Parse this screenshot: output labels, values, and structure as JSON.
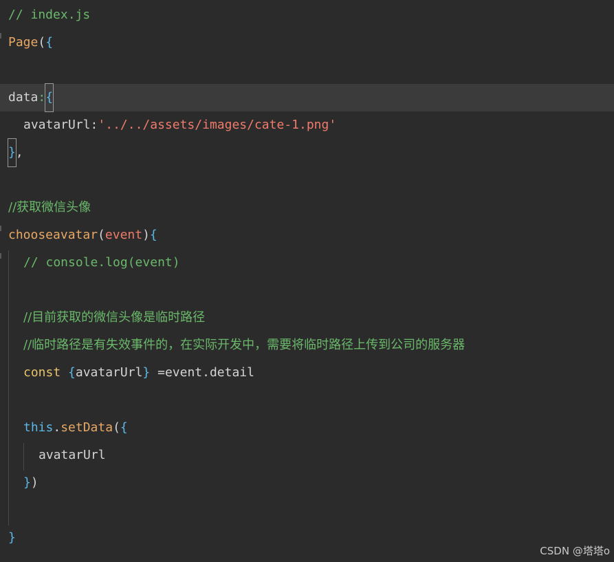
{
  "code": {
    "l1_comment": "// index.js",
    "l2_func": "Page",
    "l2_paren": "(",
    "l2_brace": "{",
    "l4_prop": "data",
    "l4_colon": ":",
    "l4_brace": "{",
    "l5_prop": "avatarUrl",
    "l5_colon": ":",
    "l5_string": "'../../assets/images/cate-1.png'",
    "l6_brace": "}",
    "l6_comma": ",",
    "l8_comment": "//获取微信头像",
    "l9_func": "chooseavatar",
    "l9_paren_open": "(",
    "l9_param": "event",
    "l9_paren_close": ")",
    "l9_brace": "{",
    "l10_comment": "// console.log(event)",
    "l12_comment": "//目前获取的微信头像是临时路径",
    "l13_comment": "//临时路径是有失效事件的，在实际开发中，需要将临时路径上传到公司的服务器",
    "l14_keyword": "const",
    "l14_brace_open": "{",
    "l14_var": "avatarUrl",
    "l14_brace_close": "}",
    "l14_rest": " =event.detail",
    "l16_this": "this",
    "l16_dot": ".",
    "l16_method": "setData",
    "l16_paren": "(",
    "l16_brace": "{",
    "l17_prop": "avatarUrl",
    "l18_brace": "}",
    "l18_paren": ")",
    "l20_brace": "}"
  },
  "watermark": "CSDN @塔塔o"
}
